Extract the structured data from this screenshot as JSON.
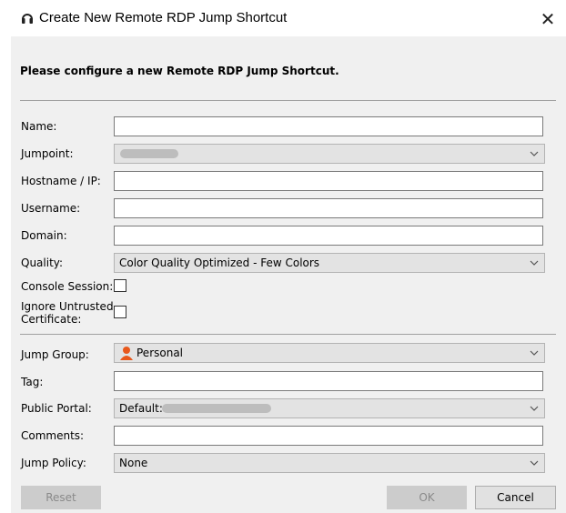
{
  "window": {
    "title": "Create New Remote RDP Jump Shortcut",
    "close_glyph": "✕"
  },
  "heading": "Please configure a new Remote RDP Jump Shortcut.",
  "fields": {
    "name": {
      "label": "Name:",
      "value": ""
    },
    "jumpoint": {
      "label": "Jumpoint:"
    },
    "hostname": {
      "label": "Hostname / IP:",
      "value": ""
    },
    "username": {
      "label": "Username:",
      "value": ""
    },
    "domain": {
      "label": "Domain:",
      "value": ""
    },
    "quality": {
      "label": "Quality:",
      "value": "Color Quality Optimized - Few Colors"
    },
    "console": {
      "label": "Console Session:",
      "checked": false
    },
    "ignore_cert": {
      "label_line1": "Ignore Untrusted",
      "label_line2": "Certificate:",
      "checked": false
    },
    "jump_group": {
      "label": "Jump Group:",
      "value": "Personal",
      "icon": "user-icon"
    },
    "tag": {
      "label": "Tag:",
      "value": ""
    },
    "public_portal": {
      "label": "Public Portal:",
      "value_prefix": "Default:"
    },
    "comments": {
      "label": "Comments:",
      "value": ""
    },
    "jump_policy": {
      "label": "Jump Policy:",
      "value": "None"
    }
  },
  "buttons": {
    "reset": "Reset",
    "ok": "OK",
    "cancel": "Cancel"
  },
  "colors": {
    "panel_bg": "#f0f0f0",
    "combo_bg": "#e3e3e3",
    "disabled_button": "#cccccc",
    "user_icon": "#e8581c"
  }
}
